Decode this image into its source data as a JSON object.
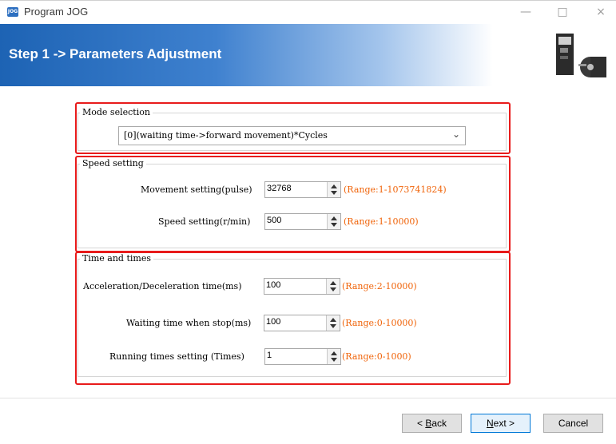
{
  "window": {
    "title": "Program JOG",
    "app_icon_text": "JOG",
    "minimize_glyph": "—",
    "maximize_glyph": "□",
    "close_glyph": "×"
  },
  "header": {
    "step_title": "Step 1 -> Parameters Adjustment",
    "illustration": "servo-motor-and-driver"
  },
  "mode_selection": {
    "title": "Mode selection",
    "selected": "[0](waiting time->forward movement)*Cycles"
  },
  "speed_setting": {
    "title": "Speed setting",
    "fields": [
      {
        "label": "Movement setting(pulse)",
        "value": "32768",
        "range": "(Range:1-1073741824)"
      },
      {
        "label": "Speed setting(r/min)",
        "value": "500",
        "range": "(Range:1-10000)"
      }
    ]
  },
  "time_and_times": {
    "title": "Time and times",
    "fields": [
      {
        "label": "Acceleration/Deceleration time(ms)",
        "value": "100",
        "range": "(Range:2-10000)"
      },
      {
        "label": "Waiting time when stop(ms)",
        "value": "100",
        "range": "(Range:0-10000)"
      },
      {
        "label": "Running times setting (Times)",
        "value": "1",
        "range": "(Range:0-1000)"
      }
    ]
  },
  "buttons": {
    "back_prefix": "< ",
    "back_key": "B",
    "back_rest": "ack",
    "next_key": "N",
    "next_rest": "ext >",
    "cancel": "Cancel"
  },
  "colors": {
    "highlight": "#e81b1b",
    "range_text": "#f0640a",
    "header_blue": "#1d63b4"
  }
}
